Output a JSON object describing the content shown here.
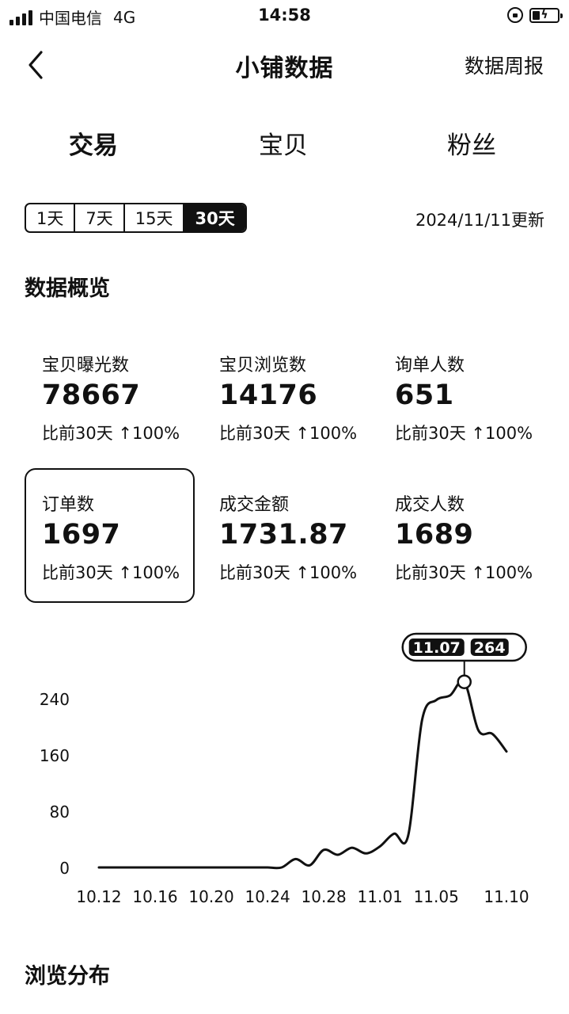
{
  "status_bar": {
    "carrier": "中国电信",
    "network": "4G",
    "time": "14:58"
  },
  "nav": {
    "title": "小铺数据",
    "right_label": "数据周报"
  },
  "tabs": [
    {
      "label": "交易",
      "active": true
    },
    {
      "label": "宝贝",
      "active": false
    },
    {
      "label": "粉丝",
      "active": false
    }
  ],
  "range": {
    "options": [
      {
        "label": "1天",
        "active": false
      },
      {
        "label": "7天",
        "active": false
      },
      {
        "label": "15天",
        "active": false
      },
      {
        "label": "30天",
        "active": true
      }
    ],
    "updated": "2024/11/11更新"
  },
  "overview": {
    "title": "数据概览",
    "metrics": [
      {
        "label": "宝贝曝光数",
        "value": "78667",
        "compare": "比前30天 ↑100%",
        "selected": false
      },
      {
        "label": "宝贝浏览数",
        "value": "14176",
        "compare": "比前30天 ↑100%",
        "selected": false
      },
      {
        "label": "询单人数",
        "value": "651",
        "compare": "比前30天 ↑100%",
        "selected": false
      },
      {
        "label": "订单数",
        "value": "1697",
        "compare": "比前30天 ↑100%",
        "selected": true
      },
      {
        "label": "成交金额",
        "value": "1731.87",
        "compare": "比前30天 ↑100%",
        "selected": false
      },
      {
        "label": "成交人数",
        "value": "1689",
        "compare": "比前30天 ↑100%",
        "selected": false
      }
    ]
  },
  "chart_data": {
    "type": "line",
    "ylim": [
      0,
      280
    ],
    "y_ticks": [
      0,
      80,
      160,
      240
    ],
    "x_ticks": [
      "10.12",
      "10.16",
      "10.20",
      "10.24",
      "10.28",
      "11.01",
      "11.05",
      "11.10"
    ],
    "x": [
      "10.12",
      "10.13",
      "10.14",
      "10.15",
      "10.16",
      "10.17",
      "10.18",
      "10.19",
      "10.20",
      "10.21",
      "10.22",
      "10.23",
      "10.24",
      "10.25",
      "10.26",
      "10.27",
      "10.28",
      "10.29",
      "10.30",
      "10.31",
      "11.01",
      "11.02",
      "11.03",
      "11.04",
      "11.05",
      "11.06",
      "11.07",
      "11.08",
      "11.09",
      "11.10"
    ],
    "series": [
      {
        "values": [
          0,
          0,
          0,
          0,
          0,
          0,
          0,
          0,
          0,
          0,
          0,
          0,
          0,
          0,
          12,
          3,
          25,
          18,
          28,
          20,
          30,
          48,
          45,
          210,
          238,
          245,
          264,
          195,
          190,
          165
        ]
      }
    ],
    "tooltip": {
      "date": "11.07",
      "value": "264"
    }
  },
  "distribution": {
    "title": "浏览分布"
  }
}
